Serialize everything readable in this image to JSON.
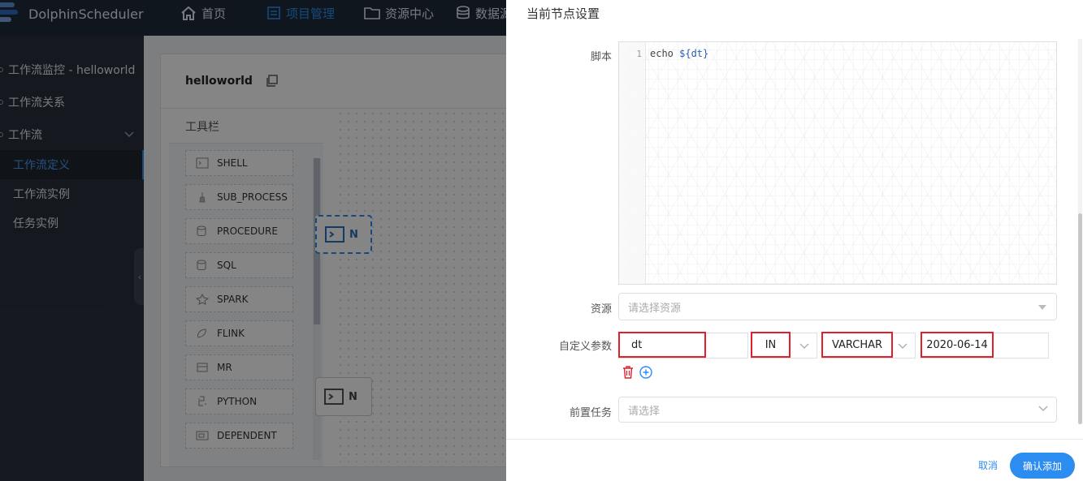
{
  "app": {
    "logo_text": "DolphinScheduler"
  },
  "topnav": {
    "items": [
      {
        "label": "首页",
        "icon": "home-icon"
      },
      {
        "label": "项目管理",
        "icon": "project-icon",
        "active": true
      },
      {
        "label": "资源中心",
        "icon": "folder-icon"
      },
      {
        "label": "数据源",
        "icon": "database-icon"
      }
    ]
  },
  "sidebar": {
    "items": [
      {
        "label": "工作流监控 - helloworld"
      },
      {
        "label": "工作流关系"
      },
      {
        "label": "工作流"
      }
    ],
    "subitems": [
      {
        "label": "工作流定义",
        "active": true
      },
      {
        "label": "工作流实例"
      },
      {
        "label": "任务实例"
      }
    ]
  },
  "canvas": {
    "title": "helloworld",
    "toolbar_title": "工具栏",
    "tools": [
      "SHELL",
      "SUB_PROCESS",
      "PROCEDURE",
      "SQL",
      "SPARK",
      "FLINK",
      "MR",
      "PYTHON",
      "DEPENDENT"
    ],
    "node_labels": [
      "N",
      "N"
    ]
  },
  "drawer": {
    "title": "当前节点设置",
    "script_label": "脚本",
    "script_line_no": "1",
    "script_cmd": "echo ",
    "script_var": "${dt}",
    "resource_label": "资源",
    "resource_placeholder": "请选择资源",
    "custom_params_label": "自定义参数",
    "param": {
      "prop": "dt",
      "direct": "IN",
      "type": "VARCHAR",
      "value": "2020-06-14"
    },
    "pre_task_label": "前置任务",
    "pre_task_placeholder": "请选择",
    "cancel_label": "取消",
    "confirm_label": "确认添加"
  },
  "colors": {
    "accent": "#2d8cf0",
    "highlight": "#e0202a",
    "nav_bg": "#1f2b3a",
    "sidebar_bg": "#2a313d"
  }
}
